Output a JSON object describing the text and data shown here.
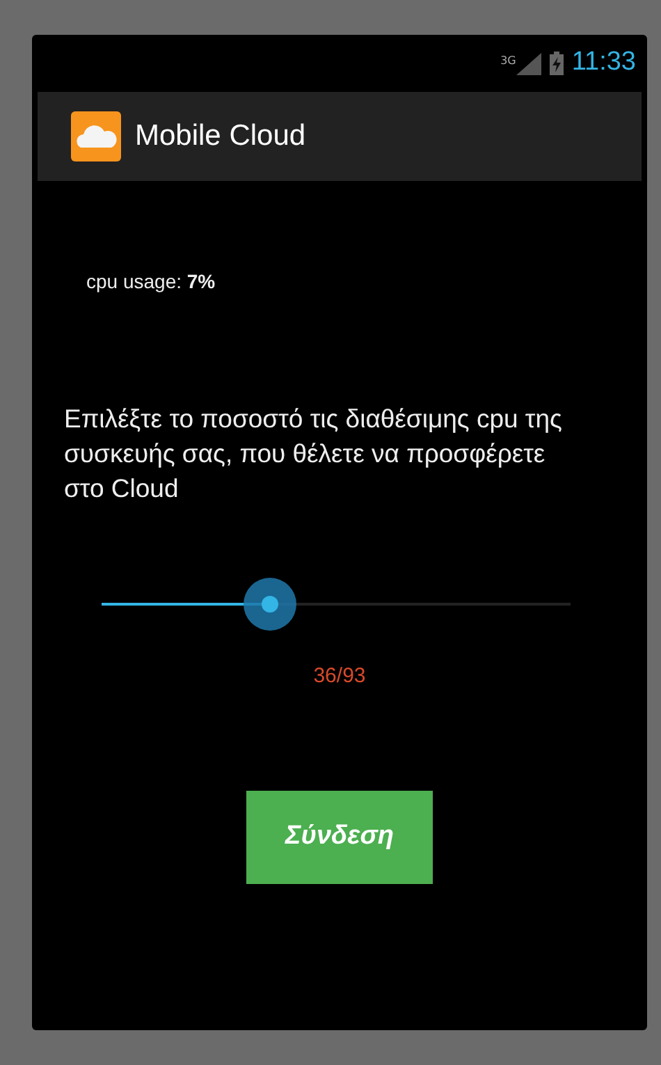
{
  "status_bar": {
    "network": "3G",
    "time": "11:33"
  },
  "action_bar": {
    "title": "Mobile Cloud"
  },
  "cpu_usage": {
    "label": "cpu usage:",
    "value": "7%"
  },
  "instruction": "Επιλέξτε το ποσοστό τις διαθέσιμης cpu της συσκευής σας, που θέλετε να προσφέρετε στο Cloud",
  "slider": {
    "level": 0.36,
    "reading": "36/93"
  },
  "connect_button": "Σύνδεση"
}
